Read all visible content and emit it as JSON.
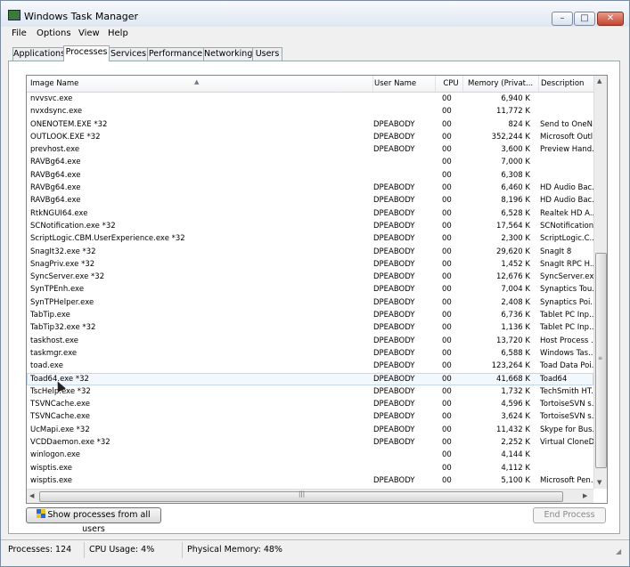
{
  "window": {
    "title": "Windows Task Manager",
    "controls": {
      "minimize": "–",
      "maximize": "□",
      "close": "✕"
    }
  },
  "menu": [
    "File",
    "Options",
    "View",
    "Help"
  ],
  "tabs": [
    "Applications",
    "Processes",
    "Services",
    "Performance",
    "Networking",
    "Users"
  ],
  "active_tab": "Processes",
  "columns": {
    "name": "Image Name",
    "user": "User Name",
    "cpu": "CPU",
    "memory": "Memory (Privat...",
    "description": "Description"
  },
  "rows": [
    {
      "name": "nvvsvc.exe",
      "user": "",
      "cpu": "00",
      "mem": "6,940 K",
      "desc": ""
    },
    {
      "name": "nvxdsync.exe",
      "user": "",
      "cpu": "00",
      "mem": "11,772 K",
      "desc": ""
    },
    {
      "name": "ONENOTEM.EXE *32",
      "user": "DPEABODY",
      "cpu": "00",
      "mem": "824 K",
      "desc": "Send to OneN..."
    },
    {
      "name": "OUTLOOK.EXE *32",
      "user": "DPEABODY",
      "cpu": "00",
      "mem": "352,244 K",
      "desc": "Microsoft Outl..."
    },
    {
      "name": "prevhost.exe",
      "user": "DPEABODY",
      "cpu": "00",
      "mem": "3,600 K",
      "desc": "Preview Hand..."
    },
    {
      "name": "RAVBg64.exe",
      "user": "",
      "cpu": "00",
      "mem": "7,000 K",
      "desc": ""
    },
    {
      "name": "RAVBg64.exe",
      "user": "",
      "cpu": "00",
      "mem": "6,308 K",
      "desc": ""
    },
    {
      "name": "RAVBg64.exe",
      "user": "DPEABODY",
      "cpu": "00",
      "mem": "6,460 K",
      "desc": "HD Audio Bac..."
    },
    {
      "name": "RAVBg64.exe",
      "user": "DPEABODY",
      "cpu": "00",
      "mem": "8,196 K",
      "desc": "HD Audio Bac..."
    },
    {
      "name": "RtkNGUI64.exe",
      "user": "DPEABODY",
      "cpu": "00",
      "mem": "6,528 K",
      "desc": "Realtek HD A..."
    },
    {
      "name": "SCNotification.exe *32",
      "user": "DPEABODY",
      "cpu": "00",
      "mem": "17,564 K",
      "desc": "SCNotification"
    },
    {
      "name": "ScriptLogic.CBM.UserExperience.exe *32",
      "user": "DPEABODY",
      "cpu": "00",
      "mem": "2,300 K",
      "desc": "ScriptLogic.C..."
    },
    {
      "name": "SnagIt32.exe *32",
      "user": "DPEABODY",
      "cpu": "00",
      "mem": "29,620 K",
      "desc": "SnagIt 8"
    },
    {
      "name": "SnagPriv.exe *32",
      "user": "DPEABODY",
      "cpu": "00",
      "mem": "1,452 K",
      "desc": "SnagIt RPC H..."
    },
    {
      "name": "SyncServer.exe *32",
      "user": "DPEABODY",
      "cpu": "00",
      "mem": "12,676 K",
      "desc": "SyncServer.ex..."
    },
    {
      "name": "SynTPEnh.exe",
      "user": "DPEABODY",
      "cpu": "00",
      "mem": "7,004 K",
      "desc": "Synaptics Tou..."
    },
    {
      "name": "SynTPHelper.exe",
      "user": "DPEABODY",
      "cpu": "00",
      "mem": "2,408 K",
      "desc": "Synaptics Poi..."
    },
    {
      "name": "TabTip.exe",
      "user": "DPEABODY",
      "cpu": "00",
      "mem": "6,736 K",
      "desc": "Tablet PC Inp..."
    },
    {
      "name": "TabTip32.exe *32",
      "user": "DPEABODY",
      "cpu": "00",
      "mem": "1,136 K",
      "desc": "Tablet PC Inp..."
    },
    {
      "name": "taskhost.exe",
      "user": "DPEABODY",
      "cpu": "00",
      "mem": "13,720 K",
      "desc": "Host Process ..."
    },
    {
      "name": "taskmgr.exe",
      "user": "DPEABODY",
      "cpu": "00",
      "mem": "6,588 K",
      "desc": "Windows Tas..."
    },
    {
      "name": "toad.exe",
      "user": "DPEABODY",
      "cpu": "00",
      "mem": "123,264 K",
      "desc": "Toad Data Poi..."
    },
    {
      "name": "Toad64.exe *32",
      "user": "DPEABODY",
      "cpu": "00",
      "mem": "41,668 K",
      "desc": "Toad64"
    },
    {
      "name": "TscHelp.exe *32",
      "user": "DPEABODY",
      "cpu": "00",
      "mem": "1,732 K",
      "desc": "TechSmith HT..."
    },
    {
      "name": "TSVNCache.exe",
      "user": "DPEABODY",
      "cpu": "00",
      "mem": "4,596 K",
      "desc": "TortoiseSVN s..."
    },
    {
      "name": "TSVNCache.exe",
      "user": "DPEABODY",
      "cpu": "00",
      "mem": "3,624 K",
      "desc": "TortoiseSVN s..."
    },
    {
      "name": "UcMapi.exe *32",
      "user": "DPEABODY",
      "cpu": "00",
      "mem": "11,432 K",
      "desc": "Skype for Bus..."
    },
    {
      "name": "VCDDaemon.exe *32",
      "user": "DPEABODY",
      "cpu": "00",
      "mem": "2,252 K",
      "desc": "Virtual CloneD..."
    },
    {
      "name": "winlogon.exe",
      "user": "",
      "cpu": "00",
      "mem": "4,144 K",
      "desc": ""
    },
    {
      "name": "wisptis.exe",
      "user": "",
      "cpu": "00",
      "mem": "4,112 K",
      "desc": ""
    },
    {
      "name": "wisptis.exe",
      "user": "DPEABODY",
      "cpu": "00",
      "mem": "5,100 K",
      "desc": "Microsoft Pen..."
    }
  ],
  "selected_row": 22,
  "buttons": {
    "show_all": "Show processes from all users",
    "end_process": "End Process"
  },
  "status": {
    "processes": "Processes: 124",
    "cpu": "CPU Usage: 4%",
    "memory": "Physical Memory: 48%"
  }
}
